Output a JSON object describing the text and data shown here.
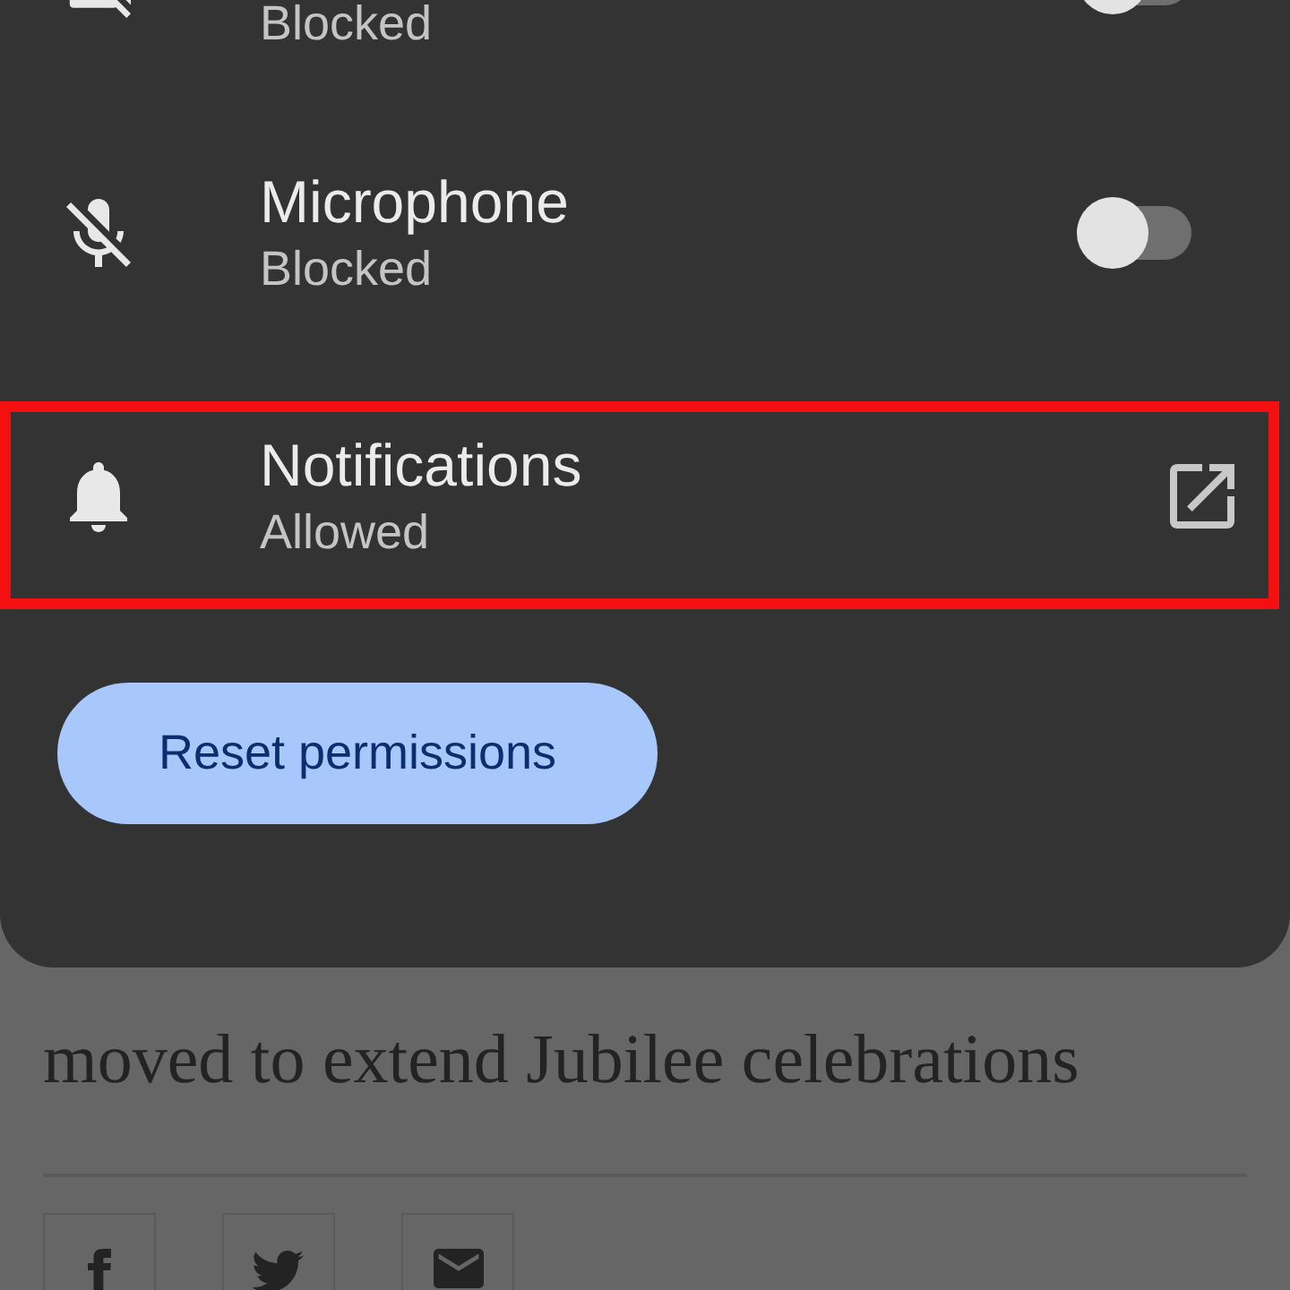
{
  "permissions_sheet": {
    "permissions": [
      {
        "kind": "toggle",
        "subtitle": "Blocked",
        "on": false,
        "highlighted": false
      },
      {
        "kind": "toggle",
        "title": "Microphone",
        "subtitle": "Blocked",
        "on": false,
        "highlighted": false
      },
      {
        "kind": "link",
        "title": "Notifications",
        "subtitle": "Allowed",
        "highlighted": true
      }
    ],
    "reset_button": "Reset permissions"
  },
  "article": {
    "paragraph": "moved to extend Jubilee celebrations",
    "share_buttons": [
      {
        "kind": "facebook"
      },
      {
        "kind": "twitter"
      },
      {
        "kind": "email"
      }
    ]
  }
}
